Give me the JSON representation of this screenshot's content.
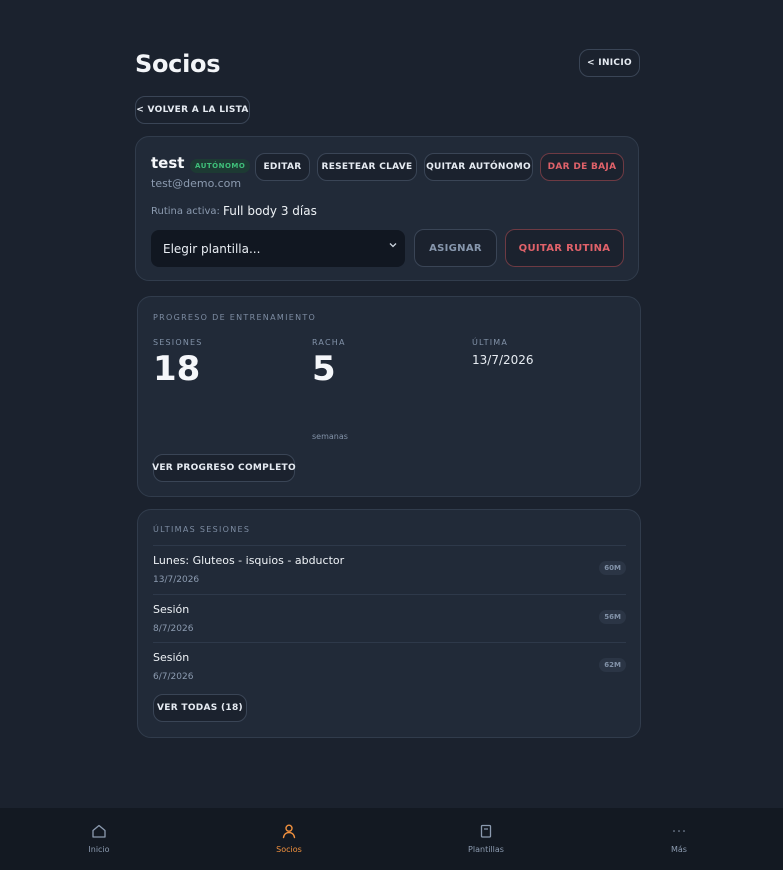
{
  "header": {
    "title": "Socios",
    "home_button": "< INICIO"
  },
  "back_button": "< VOLVER A LA LISTA",
  "member": {
    "name": "test",
    "badge": "AUTÓNOMO",
    "email": "test@demo.com",
    "actions": {
      "edit": "EDITAR",
      "reset_password": "RESETEAR CLAVE",
      "remove_autonomous": "QUITAR AUTÓNOMO",
      "deactivate": "DAR DE BAJA"
    },
    "routine_label": "Rutina activa:",
    "routine_value": "Full body 3 días",
    "template_select": {
      "selected": "Elegir plantilla..."
    },
    "assign_button": "ASIGNAR",
    "remove_routine_button": "QUITAR RUTINA"
  },
  "progress": {
    "title": "PROGRESO DE ENTRENAMIENTO",
    "sessions_label": "SESIONES",
    "sessions_value": "18",
    "streak_label": "RACHA",
    "streak_value": "5",
    "streak_unit": "semanas",
    "last_label": "ÚLTIMA",
    "last_value": "13/7/2026",
    "full_button": "VER PROGRESO COMPLETO"
  },
  "sessions": {
    "title": "ÚLTIMAS SESIONES",
    "items": [
      {
        "name": "Lunes: Gluteos - isquios - abductor",
        "date": "13/7/2026",
        "duration": "60M"
      },
      {
        "name": "Sesión",
        "date": "8/7/2026",
        "duration": "56M"
      },
      {
        "name": "Sesión",
        "date": "6/7/2026",
        "duration": "62M"
      }
    ],
    "view_all_button": "VER TODAS (18)"
  },
  "nav": {
    "items": [
      {
        "label": "Inicio",
        "icon": "home-icon"
      },
      {
        "label": "Socios",
        "icon": "user-icon",
        "active": true
      },
      {
        "label": "Plantillas",
        "icon": "clipboard-icon"
      },
      {
        "label": "Más",
        "icon": "more-icon"
      }
    ],
    "active_color": "#f2913e"
  }
}
